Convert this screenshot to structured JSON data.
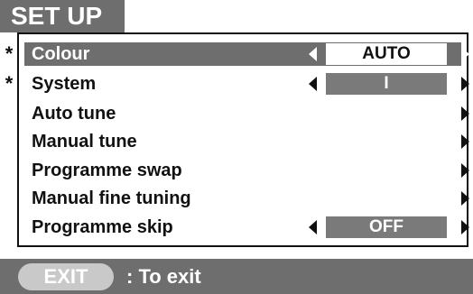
{
  "title": "SET UP",
  "marker": "*",
  "menu": [
    {
      "label": "Colour",
      "value": "AUTO",
      "has_left_arrow": true,
      "selected": true,
      "starred": true
    },
    {
      "label": "System",
      "value": "I",
      "has_left_arrow": true,
      "selected": false,
      "starred": true
    },
    {
      "label": "Auto tune",
      "value": null,
      "has_left_arrow": false,
      "selected": false,
      "starred": false
    },
    {
      "label": "Manual tune",
      "value": null,
      "has_left_arrow": false,
      "selected": false,
      "starred": false
    },
    {
      "label": "Programme swap",
      "value": null,
      "has_left_arrow": false,
      "selected": false,
      "starred": false
    },
    {
      "label": "Manual fine tuning",
      "value": null,
      "has_left_arrow": false,
      "selected": false,
      "starred": false
    },
    {
      "label": "Programme skip",
      "value": "OFF",
      "has_left_arrow": true,
      "selected": false,
      "starred": false
    }
  ],
  "footer": {
    "button_label": "EXIT",
    "text": ": To exit"
  },
  "colors": {
    "highlight": "#6e6e6e",
    "value_box": "#7a7a7a",
    "exit_pill": "#c9c9c9",
    "text": "#111111"
  }
}
